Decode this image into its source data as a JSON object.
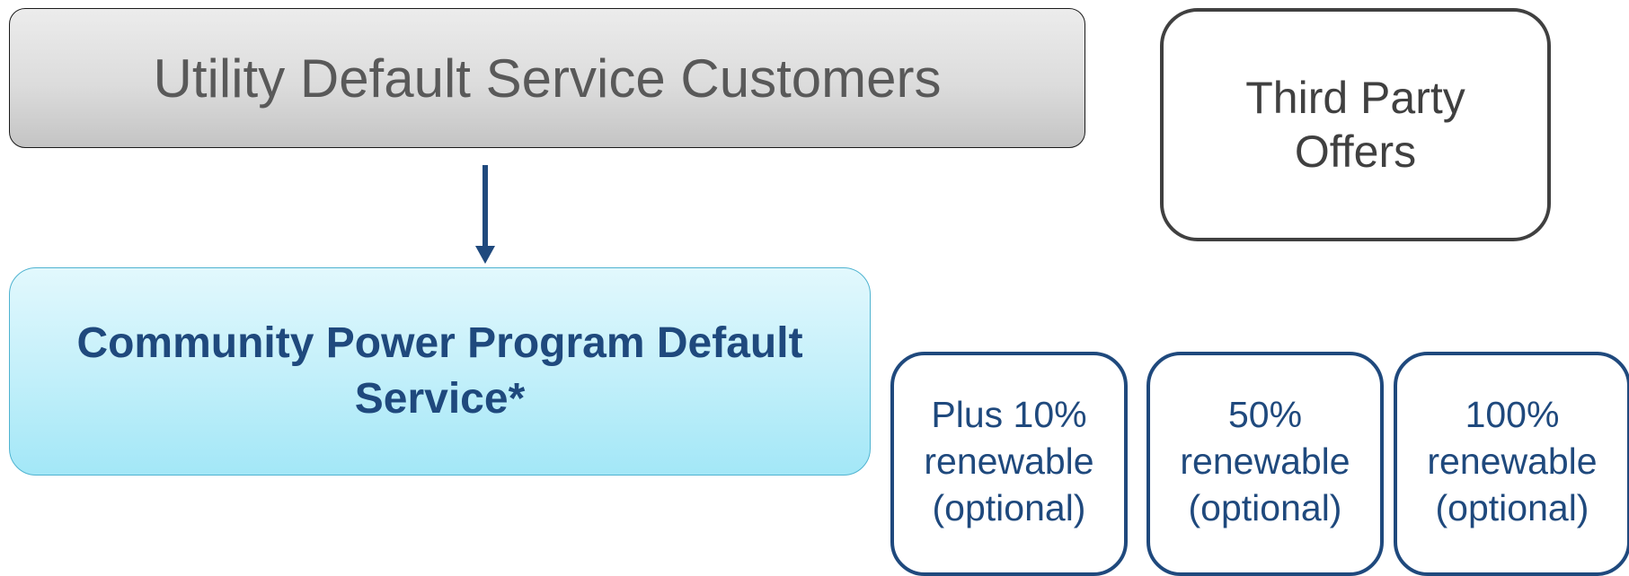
{
  "diagram": {
    "utility_box": {
      "label": "Utility Default Service Customers"
    },
    "community_box": {
      "label": "Community Power Program Default Service*"
    },
    "third_party_box": {
      "label": "Third Party\nOffers"
    },
    "options": [
      {
        "label": "Plus 10%\nrenewable\n(optional)"
      },
      {
        "label": "50%\nrenewable\n(optional)"
      },
      {
        "label": "100%\nrenewable\n(optional)"
      }
    ],
    "colors": {
      "navy": "#1f497d",
      "gray_text": "#595959",
      "dark_gray": "#404040",
      "cyan_border": "#4fb3d0",
      "arrow": "#1f497d"
    }
  }
}
